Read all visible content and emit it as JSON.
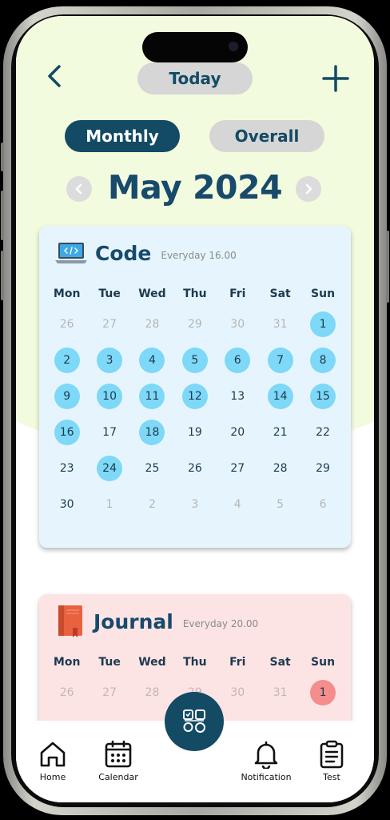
{
  "header": {
    "today_label": "Today"
  },
  "segments": {
    "monthly": "Monthly",
    "overall": "Overall"
  },
  "month_title": "May 2024",
  "weekdays": [
    "Mon",
    "Tue",
    "Wed",
    "Thu",
    "Fri",
    "Sat",
    "Sun"
  ],
  "habits": [
    {
      "name": "Code",
      "schedule": "Everyday 16.00",
      "accent": "#7ed8f7",
      "weeks": [
        [
          {
            "d": "26",
            "s": "m"
          },
          {
            "d": "27",
            "s": "m"
          },
          {
            "d": "28",
            "s": "m"
          },
          {
            "d": "29",
            "s": "m"
          },
          {
            "d": "30",
            "s": "m"
          },
          {
            "d": "31",
            "s": "m"
          },
          {
            "d": "1",
            "s": "x"
          }
        ],
        [
          {
            "d": "2",
            "s": "x"
          },
          {
            "d": "3",
            "s": "x"
          },
          {
            "d": "4",
            "s": "x"
          },
          {
            "d": "5",
            "s": "x"
          },
          {
            "d": "6",
            "s": "x"
          },
          {
            "d": "7",
            "s": "x"
          },
          {
            "d": "8",
            "s": "x"
          }
        ],
        [
          {
            "d": "9",
            "s": "x"
          },
          {
            "d": "10",
            "s": "x"
          },
          {
            "d": "11",
            "s": "x"
          },
          {
            "d": "12",
            "s": "x"
          },
          {
            "d": "13",
            "s": "n"
          },
          {
            "d": "14",
            "s": "x"
          },
          {
            "d": "15",
            "s": "x"
          }
        ],
        [
          {
            "d": "16",
            "s": "x"
          },
          {
            "d": "17",
            "s": "n"
          },
          {
            "d": "18",
            "s": "x"
          },
          {
            "d": "19",
            "s": "n"
          },
          {
            "d": "20",
            "s": "n"
          },
          {
            "d": "21",
            "s": "n"
          },
          {
            "d": "22",
            "s": "n"
          }
        ],
        [
          {
            "d": "23",
            "s": "n"
          },
          {
            "d": "24",
            "s": "x"
          },
          {
            "d": "25",
            "s": "n"
          },
          {
            "d": "26",
            "s": "n"
          },
          {
            "d": "27",
            "s": "n"
          },
          {
            "d": "28",
            "s": "n"
          },
          {
            "d": "29",
            "s": "n"
          }
        ],
        [
          {
            "d": "30",
            "s": "n"
          },
          {
            "d": "1",
            "s": "m"
          },
          {
            "d": "2",
            "s": "m"
          },
          {
            "d": "3",
            "s": "m"
          },
          {
            "d": "4",
            "s": "m"
          },
          {
            "d": "5",
            "s": "m"
          },
          {
            "d": "6",
            "s": "m"
          }
        ]
      ]
    },
    {
      "name": "Journal",
      "schedule": "Everyday 20.00",
      "accent": "#f58d8d",
      "weeks": [
        [
          {
            "d": "26",
            "s": "m"
          },
          {
            "d": "27",
            "s": "m"
          },
          {
            "d": "28",
            "s": "m"
          },
          {
            "d": "29",
            "s": "m"
          },
          {
            "d": "30",
            "s": "m"
          },
          {
            "d": "31",
            "s": "m"
          },
          {
            "d": "1",
            "s": "x"
          }
        ]
      ]
    }
  ],
  "tabbar": {
    "home": "Home",
    "calendar": "Calendar",
    "notification": "Notification",
    "test": "Test"
  },
  "icons": {
    "back": "chevron-left-icon",
    "add": "plus-icon",
    "code": "laptop-code-icon",
    "journal": "book-icon",
    "fab": "habits-grid-icon"
  }
}
